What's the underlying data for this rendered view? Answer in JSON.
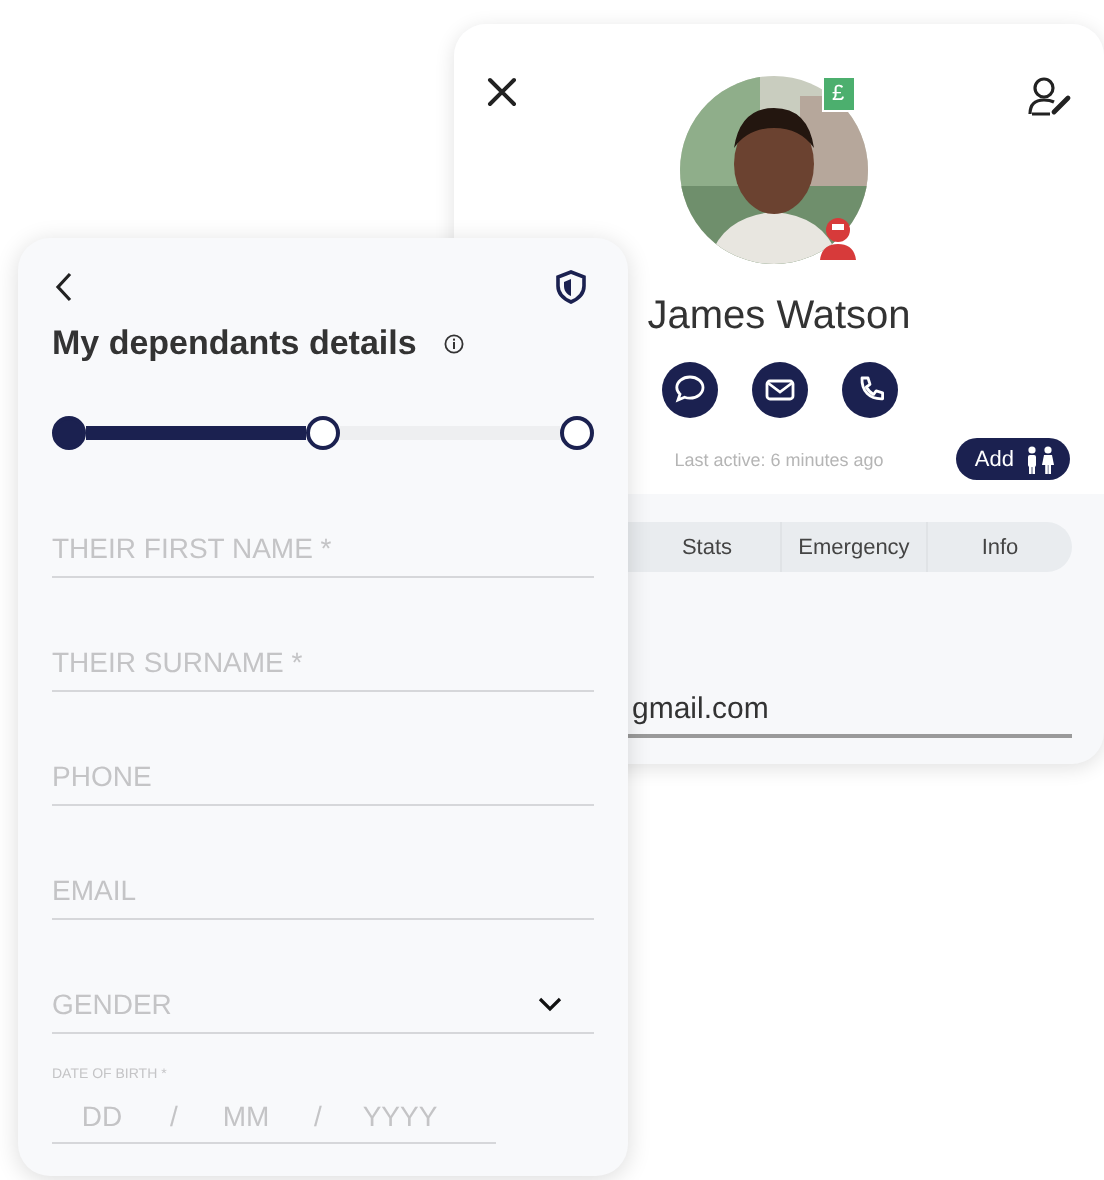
{
  "profile_card": {
    "name": "James Watson",
    "badge": "£",
    "last_active": "Last active: 6 minutes ago",
    "add_button": "Add",
    "tabs": [
      {
        "label": "Stats"
      },
      {
        "label": "Emergency"
      },
      {
        "label": "Info"
      }
    ],
    "email_value": "gmail.com"
  },
  "form_card": {
    "title": "My dependants details",
    "progress": {
      "steps": [
        {
          "kind": "complete",
          "done": true
        },
        {
          "kind": "current",
          "done": false
        },
        {
          "kind": "upcoming",
          "done": false
        }
      ]
    },
    "fields": [
      {
        "kind": "text",
        "placeholder": "THEIR FIRST NAME *"
      },
      {
        "kind": "text",
        "placeholder": "THEIR SURNAME *"
      },
      {
        "kind": "text",
        "placeholder": "PHONE"
      },
      {
        "kind": "text",
        "placeholder": "EMAIL"
      },
      {
        "kind": "select",
        "placeholder": "GENDER"
      }
    ],
    "date_of_birth": {
      "label": "DATE OF BIRTH *",
      "parts": [
        {
          "placeholder": "DD"
        },
        {
          "placeholder": "MM"
        },
        {
          "placeholder": "YYYY"
        }
      ],
      "separators": [
        "/",
        "/"
      ]
    }
  }
}
